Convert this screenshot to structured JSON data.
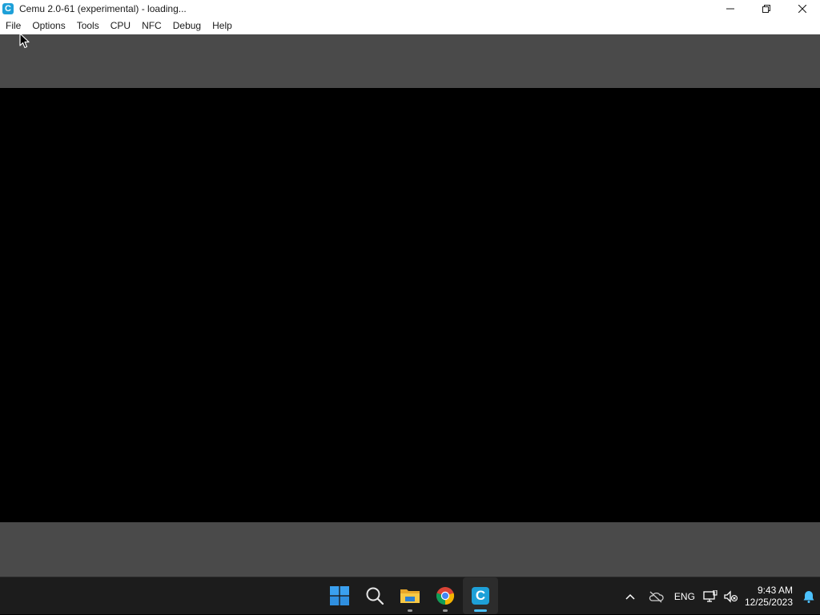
{
  "window": {
    "title": "Cemu 2.0-61 (experimental) - loading...",
    "app_icon_letter": "C",
    "controls": [
      "minimize-icon",
      "restore-icon",
      "close-icon"
    ]
  },
  "menu": {
    "items": [
      {
        "label": "File"
      },
      {
        "label": "Options"
      },
      {
        "label": "Tools"
      },
      {
        "label": "CPU"
      },
      {
        "label": "NFC"
      },
      {
        "label": "Debug"
      },
      {
        "label": "Help"
      }
    ]
  },
  "taskbar": {
    "apps": [
      {
        "icon": "windows-start-icon"
      },
      {
        "icon": "search-icon"
      },
      {
        "icon": "file-explorer-icon",
        "running": true
      },
      {
        "icon": "chrome-icon",
        "running": true
      },
      {
        "icon": "cemu-icon",
        "running": true,
        "active": true,
        "letter": "C"
      }
    ],
    "tray": {
      "language": "ENG",
      "time": "9:43 AM",
      "date": "12/25/2023"
    }
  },
  "colors": {
    "letterbox_gray": "#4a4a4a",
    "game_view": "#000000",
    "taskbar": "#1c1c1c",
    "accent": "#4cc2ff",
    "cemu_brand": "#1ea0d8"
  }
}
